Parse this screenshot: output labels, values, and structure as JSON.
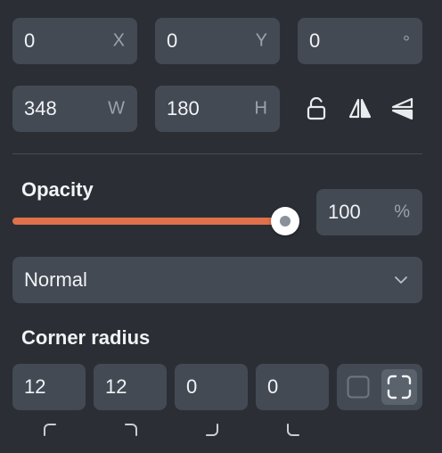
{
  "position": {
    "x": {
      "value": "0",
      "unit": "X"
    },
    "y": {
      "value": "0",
      "unit": "Y"
    },
    "rotation": {
      "value": "0",
      "unit": "°"
    }
  },
  "size": {
    "w": {
      "value": "348",
      "unit": "W"
    },
    "h": {
      "value": "180",
      "unit": "H"
    }
  },
  "icons": {
    "lock": "unlocked-lock-icon",
    "flip_horizontal": "flip-horizontal-icon",
    "flip_vertical": "flip-vertical-icon"
  },
  "opacity": {
    "label": "Opacity",
    "value": "100",
    "unit": "%",
    "fraction": 1.0,
    "slider_color": "#e0714a"
  },
  "blend_mode": {
    "selected": "Normal"
  },
  "corner_radius": {
    "label": "Corner radius",
    "top_left": "12",
    "top_right": "12",
    "bottom_right": "0",
    "bottom_left": "0"
  },
  "colors": {
    "background": "#2b2f35",
    "field": "#434a53",
    "accent": "#e0714a"
  }
}
